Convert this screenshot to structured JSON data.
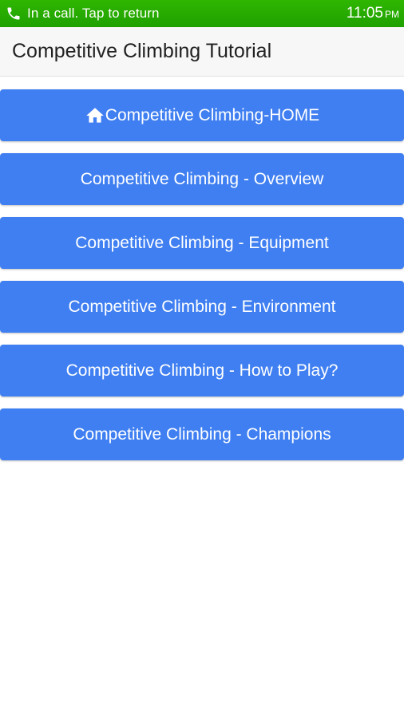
{
  "status_bar": {
    "call_text": "In a call. Tap to return",
    "time": "11:05",
    "ampm": "PM",
    "icon": "phone-icon",
    "color": "#27ad00"
  },
  "app_bar": {
    "title": "Competitive Climbing Tutorial"
  },
  "menu": {
    "items": [
      {
        "label": "Competitive Climbing-HOME",
        "icon": "home-icon"
      },
      {
        "label": "Competitive Climbing - Overview"
      },
      {
        "label": "Competitive Climbing - Equipment"
      },
      {
        "label": "Competitive Climbing - Environment"
      },
      {
        "label": "Competitive Climbing - How to Play?"
      },
      {
        "label": "Competitive Climbing - Champions"
      }
    ],
    "button_color": "#3f7ff1"
  }
}
